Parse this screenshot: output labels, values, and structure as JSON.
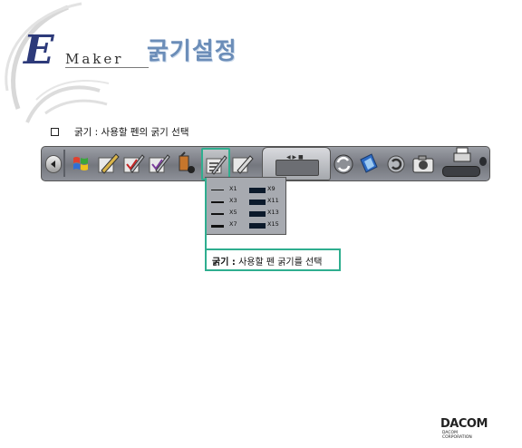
{
  "header": {
    "brand_e": "E",
    "brand_maker": "Maker",
    "title": "굵기설정"
  },
  "section": {
    "bullet_text": "굵기 : 사용할 펜의 굵기 선택"
  },
  "toolbar": {
    "buttons": [
      "back-arrow-icon",
      "windows-flag-icon",
      "pen-icon",
      "pen-check-icon",
      "pen-check2-icon",
      "bucket-icon",
      "thickness-icon",
      "eraser-icon",
      "control-panel",
      "refresh-icon",
      "screen-icon",
      "undo-icon",
      "camera-icon",
      "printer-icon",
      "power-icon"
    ],
    "highlight_color": "#2fae8f"
  },
  "thickness_menu": {
    "options_left": [
      {
        "label": "X1",
        "weight": 1
      },
      {
        "label": "X3",
        "weight": 2
      },
      {
        "label": "X5",
        "weight": 3
      },
      {
        "label": "X7",
        "weight": 4
      }
    ],
    "options_right": [
      {
        "label": "X9",
        "weight": 5
      },
      {
        "label": "X11",
        "weight": 6
      },
      {
        "label": "X13",
        "weight": 6
      },
      {
        "label": "X15",
        "weight": 6
      }
    ]
  },
  "callout": {
    "bold": "굵기 :",
    "rest": " 사용할 펜 굵기를 선택"
  },
  "footer": {
    "logo_main": "DACOM",
    "logo_line1": "DACOM",
    "logo_line2": "CORPORATION"
  }
}
